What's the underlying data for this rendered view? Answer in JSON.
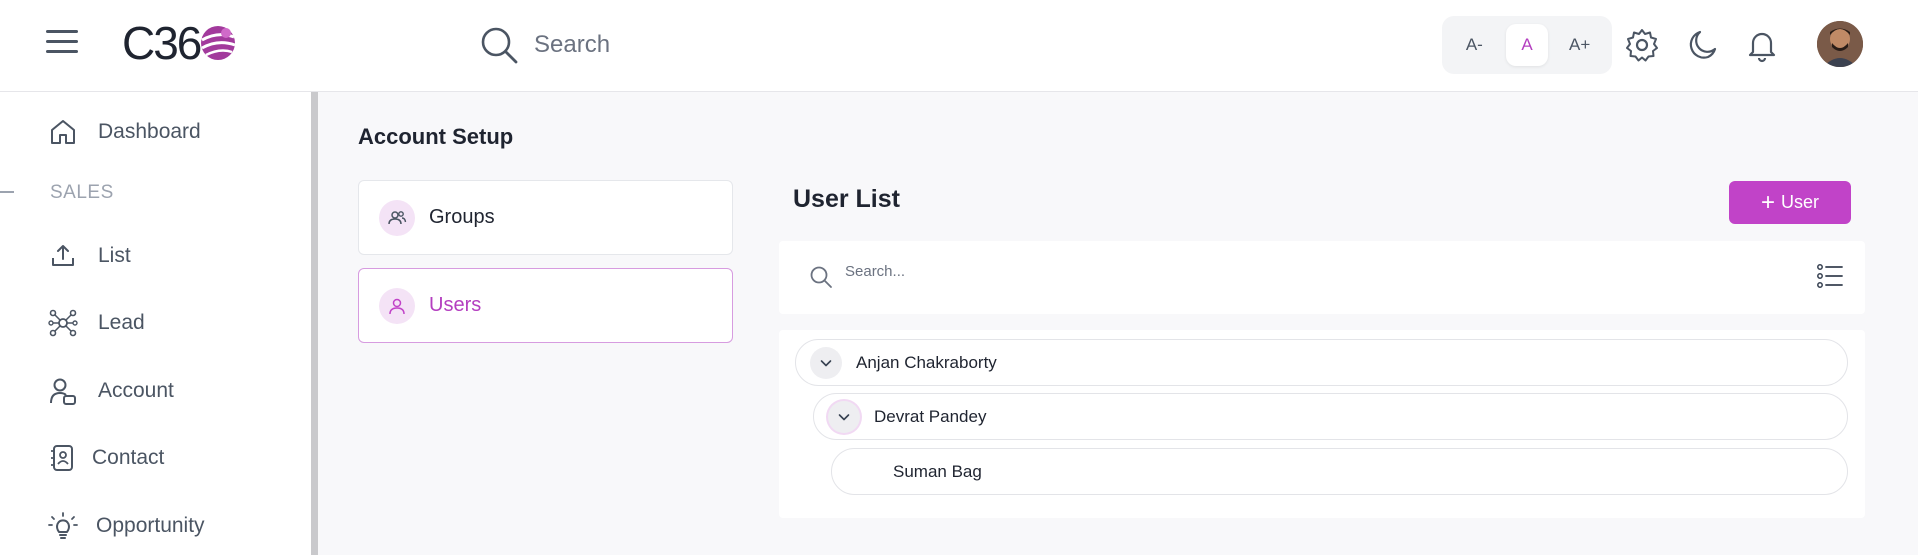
{
  "header": {
    "logo_text": "C36",
    "search_placeholder": "Search",
    "font_sizes": [
      "A-",
      "A",
      "A+"
    ],
    "active_font_size": "A"
  },
  "sidebar": {
    "items": [
      {
        "label": "Dashboard",
        "icon": "home-icon"
      },
      {
        "label": "List",
        "icon": "upload-icon"
      },
      {
        "label": "Lead",
        "icon": "network-icon"
      },
      {
        "label": "Account",
        "icon": "account-icon"
      },
      {
        "label": "Contact",
        "icon": "contact-book-icon"
      },
      {
        "label": "Opportunity",
        "icon": "lightbulb-icon"
      }
    ],
    "section_label": "SALES"
  },
  "main": {
    "page_title": "Account Setup",
    "menu": [
      {
        "label": "Groups",
        "icon": "group-icon",
        "active": false
      },
      {
        "label": "Users",
        "icon": "user-icon",
        "active": true
      }
    ],
    "list_title": "User List",
    "add_button_label": "User",
    "list_search_placeholder": "Search...",
    "tree": [
      {
        "name": "Anjan Chakraborty",
        "level": 0,
        "expandable": true
      },
      {
        "name": "Devrat Pandey",
        "level": 1,
        "expandable": true
      },
      {
        "name": "Suman Bag",
        "level": 2,
        "expandable": false
      }
    ]
  },
  "colors": {
    "accent": "#c143c8",
    "accent_text": "#b43fc0",
    "bubble_bg": "#f4e3f6"
  }
}
